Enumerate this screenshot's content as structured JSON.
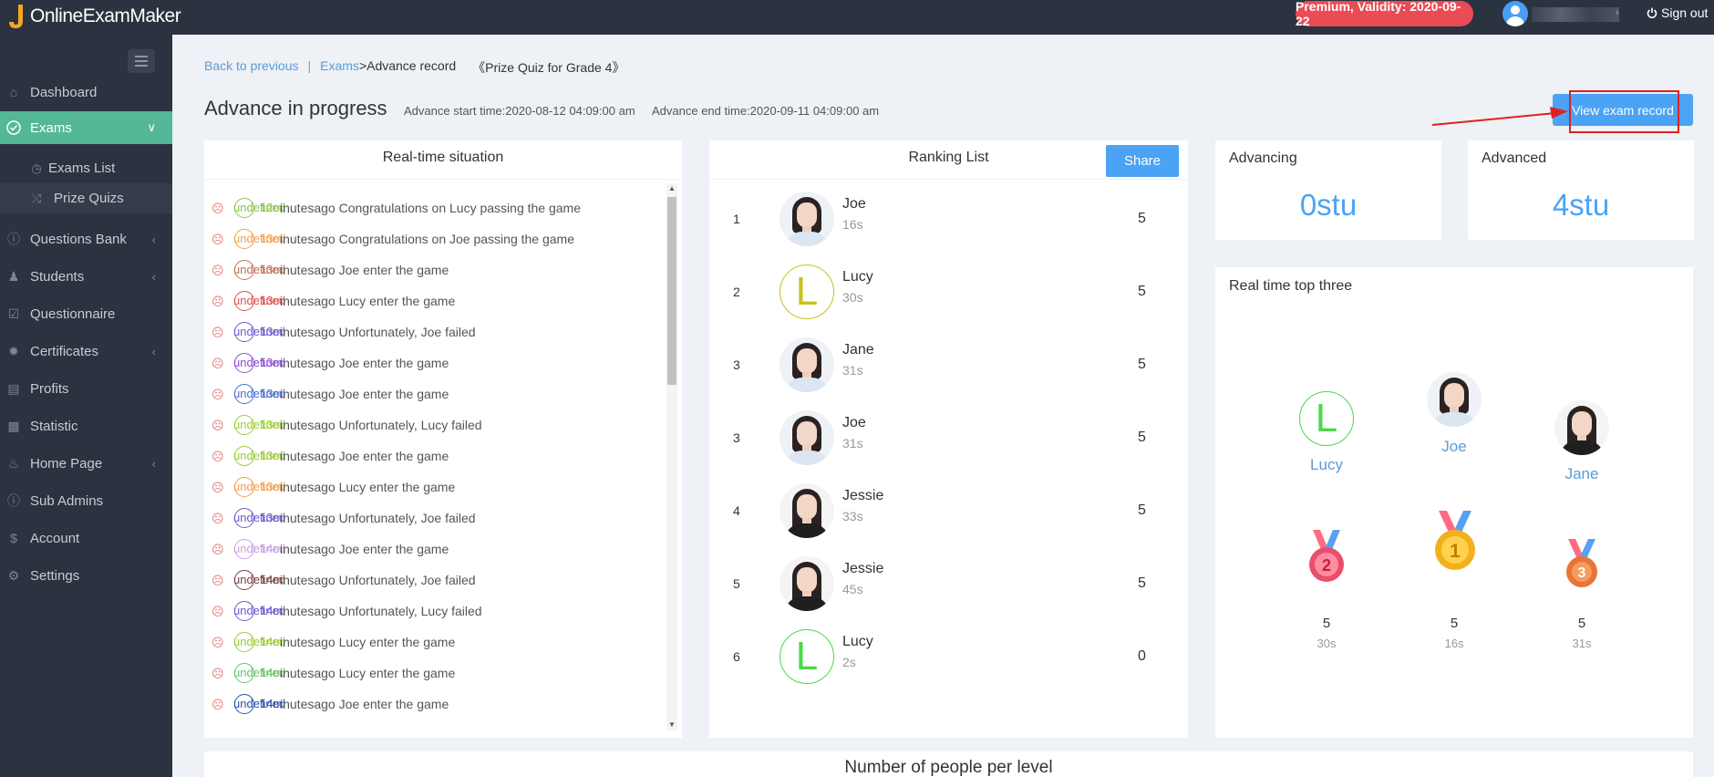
{
  "app": {
    "logo_text": "OnlineExamMaker"
  },
  "header": {
    "premium_badge": "Premium, Validity: 2020-09-22",
    "sign_out": "Sign out"
  },
  "sidebar": {
    "items": [
      {
        "label": "Dashboard",
        "icon": "home-icon"
      },
      {
        "label": "Exams",
        "icon": "check-circle-icon",
        "active": true
      },
      {
        "label": "Questions Bank",
        "icon": "question-circle-icon"
      },
      {
        "label": "Students",
        "icon": "user-icon"
      },
      {
        "label": "Questionnaire",
        "icon": "checkbox-icon"
      },
      {
        "label": "Certificates",
        "icon": "badge-icon"
      },
      {
        "label": "Profits",
        "icon": "card-icon"
      },
      {
        "label": "Statistic",
        "icon": "bar-chart-icon"
      },
      {
        "label": "Home Page",
        "icon": "home-page-icon"
      },
      {
        "label": "Sub Admins",
        "icon": "question-circle-icon"
      },
      {
        "label": "Account",
        "icon": "dollar-icon"
      },
      {
        "label": "Settings",
        "icon": "gear-icon"
      }
    ],
    "subitems": [
      {
        "label": "Exams List",
        "icon": "clock-icon"
      },
      {
        "label": "Prize Quizs",
        "icon": "shuffle-icon",
        "selected": true
      }
    ]
  },
  "breadcrumb": {
    "back": "Back to previous",
    "sep": "|",
    "exams": "Exams",
    "current": ">Advance record",
    "quiz": "《Prize Quiz for Grade 4》"
  },
  "page": {
    "title": "Advance in progress",
    "start": "Advance start time:2020-08-12 04:09:00 am",
    "end": "Advance end time:2020-09-11 04:09:00 am",
    "view_button": "View exam record"
  },
  "realtime": {
    "title": "Real-time situation",
    "undefined_text": "undefined",
    "rows": [
      {
        "time": "12m",
        "text": "inutesago Congratulations on Lucy passing the game",
        "color": "#8bc34a"
      },
      {
        "time": "13m",
        "text": "inutesago Congratulations on Joe passing the game",
        "color": "#f0a050"
      },
      {
        "time": "13m",
        "text": "inutesago Joe enter the game",
        "color": "#c0705a"
      },
      {
        "time": "13m",
        "text": "inutesago Lucy enter the game",
        "color": "#d9534f"
      },
      {
        "time": "13m",
        "text": "inutesago Unfortunately, Joe failed",
        "color": "#6a5acd"
      },
      {
        "time": "13m",
        "text": "inutesago Joe enter the game",
        "color": "#8a4fd0"
      },
      {
        "time": "13m",
        "text": "inutesago Joe enter the game",
        "color": "#4a6fd0"
      },
      {
        "time": "13m",
        "text": "inutesago Unfortunately, Lucy failed",
        "color": "#9acd32"
      },
      {
        "time": "13m",
        "text": "inutesago Joe enter the game",
        "color": "#9acd32"
      },
      {
        "time": "13m",
        "text": "inutesago Lucy enter the game",
        "color": "#f0a050"
      },
      {
        "time": "13m",
        "text": "inutesago Unfortunately, Joe failed",
        "color": "#6a5acd"
      },
      {
        "time": "14m",
        "text": "inutesago Joe enter the game",
        "color": "#c8a0e0"
      },
      {
        "time": "14m",
        "text": "inutesago Unfortunately, Joe failed",
        "color": "#7a4040"
      },
      {
        "time": "14m",
        "text": "inutesago Unfortunately, Lucy failed",
        "color": "#6a5acd"
      },
      {
        "time": "14m",
        "text": "inutesago Lucy enter the game",
        "color": "#9acd32"
      },
      {
        "time": "14m",
        "text": "inutesago Lucy enter the game",
        "color": "#6abf69"
      },
      {
        "time": "14m",
        "text": "inutesago Joe enter the game",
        "color": "#2a4fb0"
      }
    ]
  },
  "ranking": {
    "title": "Ranking List",
    "share": "Share",
    "rows": [
      {
        "pos": "1",
        "name": "Joe",
        "time": "16s",
        "score": "5",
        "avatar": "photo-light"
      },
      {
        "pos": "2",
        "name": "Lucy",
        "time": "30s",
        "score": "5",
        "avatar": "letter",
        "letter": "L",
        "color": "#c9c21c"
      },
      {
        "pos": "3",
        "name": "Jane",
        "time": "31s",
        "score": "5",
        "avatar": "photo-light"
      },
      {
        "pos": "3",
        "name": "Joe",
        "time": "31s",
        "score": "5",
        "avatar": "photo-light"
      },
      {
        "pos": "4",
        "name": "Jessie",
        "time": "33s",
        "score": "5",
        "avatar": "photo-dark"
      },
      {
        "pos": "5",
        "name": "Jessie",
        "time": "45s",
        "score": "5",
        "avatar": "photo-dark"
      },
      {
        "pos": "6",
        "name": "Lucy",
        "time": "2s",
        "score": "0",
        "avatar": "letter",
        "letter": "L",
        "color": "#4cd84c"
      }
    ]
  },
  "stats": {
    "advancing_label": "Advancing",
    "advancing_value": "0stu",
    "advanced_label": "Advanced",
    "advanced_value": "4stu"
  },
  "top_three": {
    "title": "Real time top three",
    "second": {
      "name": "Lucy",
      "letter": "L",
      "score": "5",
      "time": "30s",
      "medal": "2"
    },
    "first": {
      "name": "Joe",
      "score": "5",
      "time": "16s",
      "medal": "1"
    },
    "third": {
      "name": "Jane",
      "score": "5",
      "time": "31s",
      "medal": "3"
    }
  },
  "level": {
    "title": "Number of people per level"
  },
  "colors": {
    "accent": "#4ba3f5",
    "sidebar": "#2b3340",
    "active": "#54b798",
    "premium": "#ea4b55"
  }
}
